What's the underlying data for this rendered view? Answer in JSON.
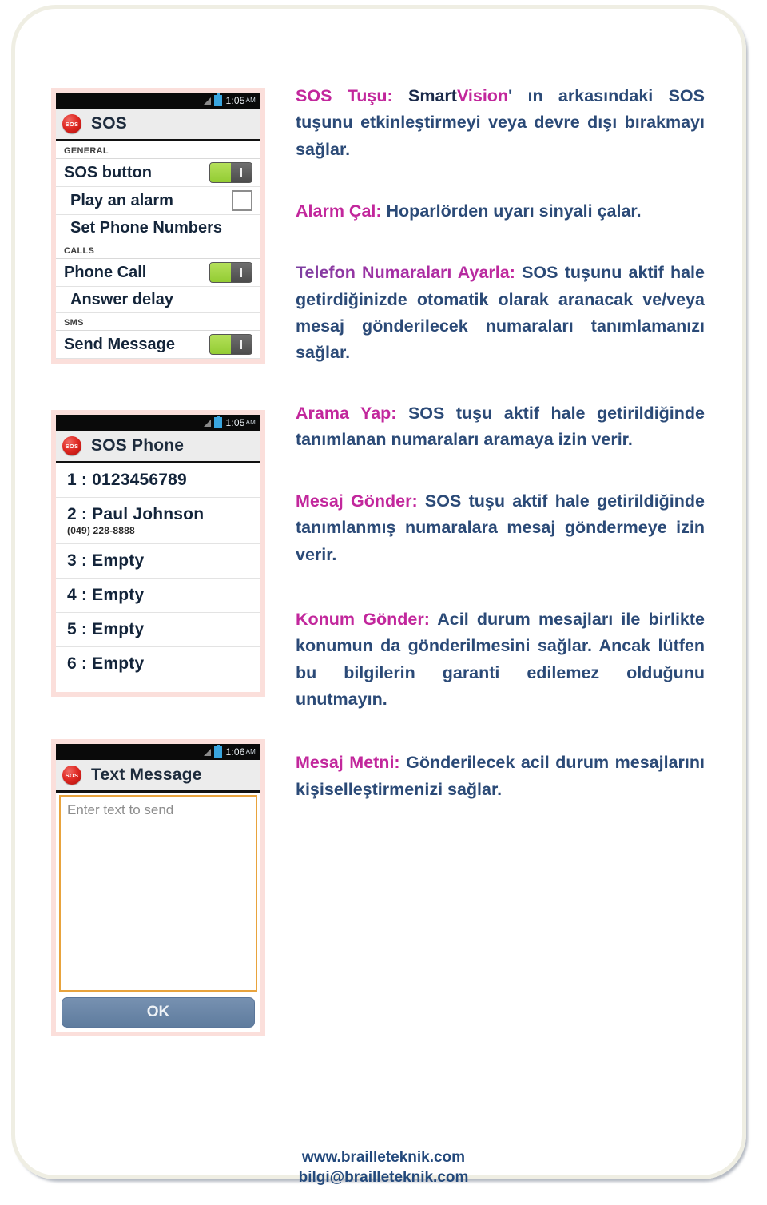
{
  "screenshots": [
    {
      "id": "sos-settings",
      "statusbar": {
        "time": "1:05",
        "ampm": "AM",
        "signal_icon": "signal-bars-icon",
        "battery_icon": "battery-icon"
      },
      "actionbar": {
        "badge": "SOS",
        "title": "SOS"
      },
      "sections": [
        {
          "header": "GENERAL",
          "rows": [
            {
              "label": "SOS button",
              "control": "toggle",
              "state": "on"
            },
            {
              "label": "Play an alarm",
              "control": "checkbox",
              "state": "off"
            },
            {
              "label": "Set Phone Numbers",
              "control": "none",
              "state": ""
            }
          ]
        },
        {
          "header": "CALLS",
          "rows": [
            {
              "label": "Phone Call",
              "control": "toggle",
              "state": "on"
            },
            {
              "label": "Answer delay",
              "control": "none",
              "state": ""
            }
          ]
        },
        {
          "header": "SMS",
          "rows": [
            {
              "label": "Send Message",
              "control": "toggle",
              "state": "on"
            }
          ]
        }
      ]
    },
    {
      "id": "sos-phone-list",
      "statusbar": {
        "time": "1:05",
        "ampm": "AM",
        "signal_icon": "signal-bars-icon",
        "battery_icon": "battery-icon"
      },
      "actionbar": {
        "badge": "SOS",
        "title": "SOS Phone"
      },
      "entries": [
        {
          "main": "1 : 0123456789",
          "sub": ""
        },
        {
          "main": "2 : Paul Johnson",
          "sub": "(049) 228-8888"
        },
        {
          "main": "3 : Empty",
          "sub": ""
        },
        {
          "main": "4 : Empty",
          "sub": ""
        },
        {
          "main": "5 : Empty",
          "sub": ""
        },
        {
          "main": "6 : Empty",
          "sub": ""
        }
      ]
    },
    {
      "id": "text-message",
      "statusbar": {
        "time": "1:06",
        "ampm": "AM",
        "signal_icon": "signal-bars-icon",
        "battery_icon": "battery-icon"
      },
      "actionbar": {
        "badge": "SOS",
        "title": "Text Message"
      },
      "textarea": {
        "value": "",
        "placeholder": "Enter text to send"
      },
      "ok_label": "OK"
    }
  ],
  "body": {
    "p1": {
      "term": "SOS Tuşu:",
      "brand_a": "Smart",
      "brand_b": "Vision",
      "rest": "' ın arkasındaki SOS tuşunu etkinleştirmeyi veya devre dışı bırakmayı sağlar."
    },
    "p2": {
      "term": "Alarm Çal:",
      "rest": " Hoparlörden uyarı sinyali çalar."
    },
    "p3": {
      "term": "Telefon Numaraları Ayarla:",
      "rest": " SOS tuşunu aktif hale getirdiğinizde otomatik olarak aranacak ve/veya mesaj gönderilecek numaraları tanımlamanızı sağlar."
    },
    "p4": {
      "term": "Arama Yap:",
      "rest": " SOS tuşu aktif hale getirildiğinde tanımlanan numaraları aramaya izin verir."
    },
    "p5": {
      "term": "Mesaj Gönder:",
      "rest": " SOS tuşu aktif hale getirildiğinde tanımlanmış numaralara mesaj göndermeye izin verir."
    },
    "p6": {
      "term": "Konum Gönder:",
      "rest": " Acil durum mesajları ile birlikte konumun da gönderilmesini sağlar. Ancak lütfen bu bilgilerin garanti edilemez olduğunu unutmayın."
    },
    "p7": {
      "term": "Mesaj Metni:",
      "rest": " Gönderilecek acil durum mesajlarını kişiselleştirmenizi sağlar."
    }
  },
  "footer": {
    "website": "www.brailleteknik.com",
    "email": "bilgi@brailleteknik.com"
  },
  "colors": {
    "term_magenta": "#c2279c",
    "body_navy": "#2b4a77",
    "footer_navy": "#23497c",
    "frame_cream": "#efeee3",
    "shot_frame_pink": "#fbdfdb",
    "toggle_green": "#93cc33",
    "sos_red": "#e02a24",
    "ok_slate": "#5f7c9e",
    "textarea_orange": "#e8a33d"
  }
}
